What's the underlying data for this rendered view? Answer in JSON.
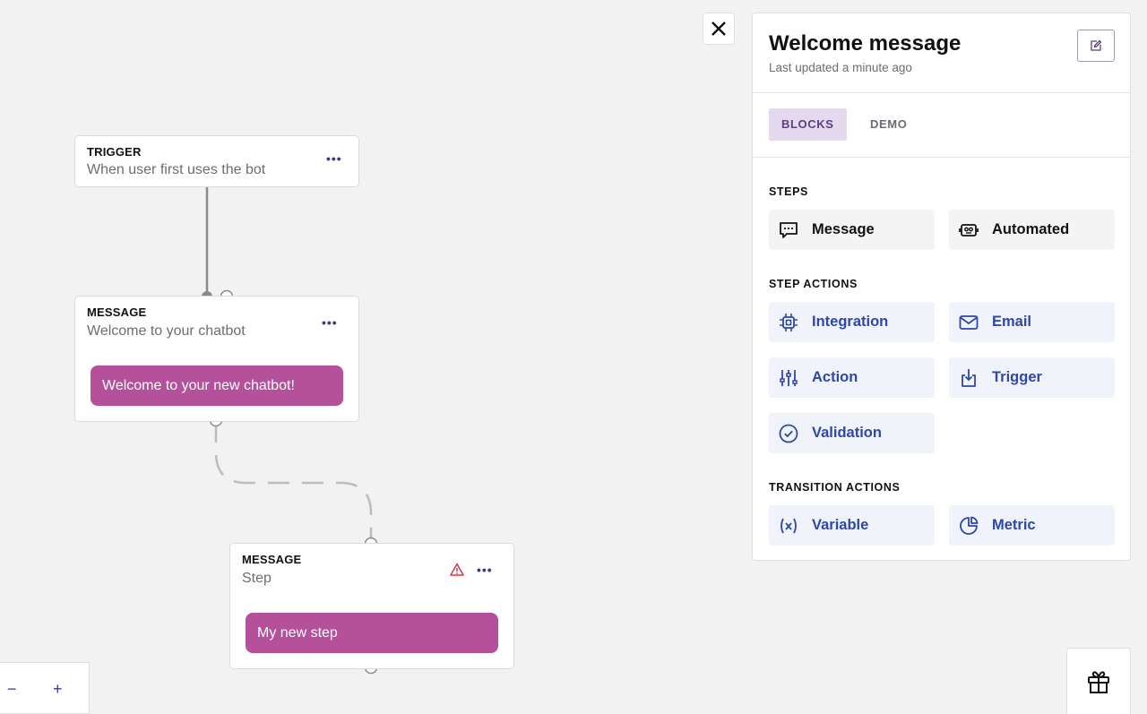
{
  "nodes": [
    {
      "type": "TRIGGER",
      "title": "When user first uses the bot"
    },
    {
      "type": "MESSAGE",
      "title": "Welcome to your chatbot",
      "bubble": "Welcome to your new chatbot!"
    },
    {
      "type": "MESSAGE",
      "title": "Step",
      "bubble": "My new step",
      "has_warning": true
    }
  ],
  "more_menu": "•••",
  "panel": {
    "title": "Welcome message",
    "subtitle": "Last updated a minute ago",
    "tabs": [
      {
        "label": "BLOCKS",
        "active": true
      },
      {
        "label": "DEMO",
        "active": false
      }
    ],
    "sections": {
      "steps": {
        "label": "STEPS",
        "items": [
          {
            "label": "Message",
            "icon": "chat-bubble-icon"
          },
          {
            "label": "Automated",
            "icon": "robot-icon"
          }
        ]
      },
      "step_actions": {
        "label": "STEP ACTIONS",
        "items": [
          {
            "label": "Integration",
            "icon": "chip-icon"
          },
          {
            "label": "Email",
            "icon": "envelope-icon"
          },
          {
            "label": "Action",
            "icon": "sliders-icon"
          },
          {
            "label": "Trigger",
            "icon": "tap-icon"
          },
          {
            "label": "Validation",
            "icon": "check-circle-icon"
          }
        ]
      },
      "transition_actions": {
        "label": "TRANSITION ACTIONS",
        "items": [
          {
            "label": "Variable",
            "icon": "variable-icon"
          },
          {
            "label": "Metric",
            "icon": "pie-chart-icon"
          }
        ]
      }
    }
  },
  "zoom": {
    "minus": "−",
    "plus": "+"
  },
  "colors": {
    "canvas_bg": "#f2f2f3",
    "bubble": "#b5519b",
    "accent_blue": "#2e47a8",
    "tab_active_bg": "#e4d9ed",
    "warning": "#e0304a"
  }
}
